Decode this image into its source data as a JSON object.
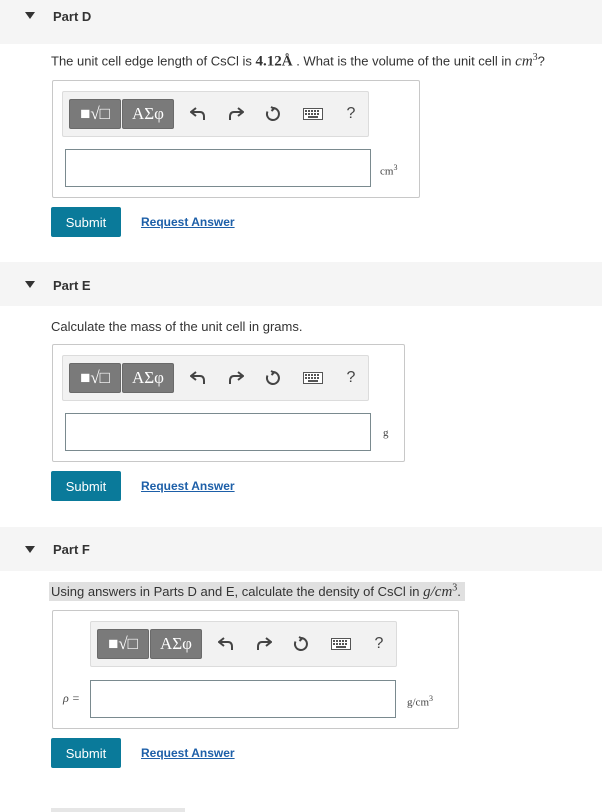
{
  "parts": [
    {
      "title": "Part D",
      "question_prefix": "The unit cell edge length of CsCl is ",
      "question_value": "4.12Å",
      "question_mid": " . What is the volume of the unit cell in ",
      "question_unit_main": "cm",
      "question_unit_sup": "3",
      "question_suffix": "?",
      "unit_main": "cm",
      "unit_sup": "3",
      "input_value": "",
      "submit_label": "Submit",
      "request_label": "Request Answer"
    },
    {
      "title": "Part E",
      "question": "Calculate the mass of the unit cell in grams.",
      "unit_main": "g",
      "input_value": "",
      "submit_label": "Submit",
      "request_label": "Request Answer"
    },
    {
      "title": "Part F",
      "question_prefix": "Using answers in Parts D and E, calculate the density of CsCl in ",
      "question_unit_main": "g/cm",
      "question_unit_sup": "3",
      "question_suffix": ".",
      "input_label": "ρ =",
      "unit_main": "g/cm",
      "unit_sup": "3",
      "input_value": "",
      "submit_label": "Submit",
      "request_label": "Request Answer"
    }
  ],
  "toolbar": {
    "template_glyph": "■√□",
    "greek_glyph": "ΑΣφ",
    "help_glyph": "?"
  },
  "icons": {
    "caret": "caret-down-icon",
    "undo": "undo-icon",
    "redo": "redo-icon",
    "reset": "reset-icon",
    "keyboard": "keyboard-icon",
    "help": "help-icon"
  },
  "colors": {
    "submit": "#0a7a9a",
    "link": "#1d5fa8",
    "header_bg": "#f5f5f5"
  }
}
